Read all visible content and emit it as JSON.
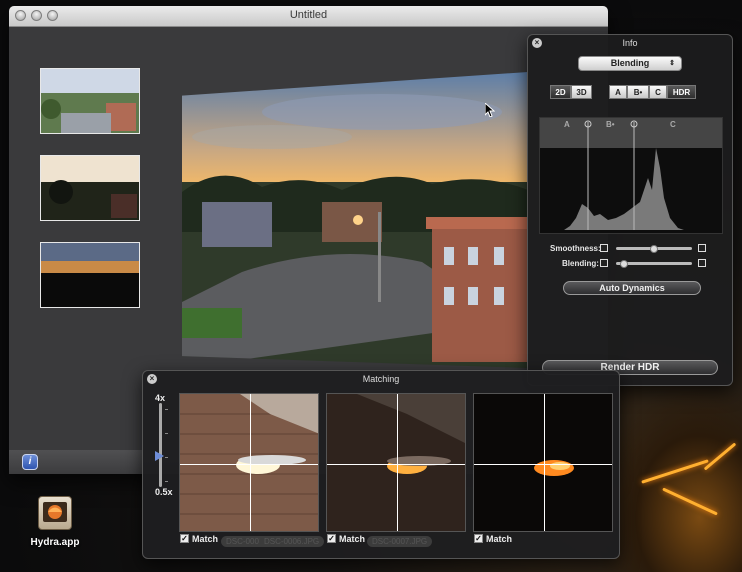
{
  "window": {
    "title": "Untitled",
    "thumbnails": [
      "thumb-bright",
      "thumb-medium",
      "thumb-dark"
    ],
    "info_button": "i"
  },
  "info_panel": {
    "title": "Info",
    "mode_select": "Blending",
    "view_toggle": [
      "2D",
      "3D"
    ],
    "channel_toggle": [
      "A",
      "B•",
      "C",
      "HDR"
    ],
    "histogram_markers": [
      "A",
      "B•",
      "C"
    ],
    "smoothness_label": "Smoothness:",
    "smoothness_value": 0.5,
    "blending_label": "Blending:",
    "blending_value": 0.1,
    "auto_dynamics": "Auto Dynamics",
    "render_hdr": "Render HDR"
  },
  "matching_panel": {
    "title": "Matching",
    "zoom_max": "4x",
    "zoom_min": "0.5x",
    "images": [
      {
        "match_label": "Match",
        "checked": true,
        "ghost_text": [
          "DSC-0008.JPG",
          "DSC-0006.JPG"
        ]
      },
      {
        "match_label": "Match",
        "checked": true,
        "ghost_text": [
          "DSC-0007.JPG"
        ]
      },
      {
        "match_label": "Match",
        "checked": true,
        "ghost_text": []
      }
    ]
  },
  "desktop": {
    "app_label": "Hydra.app"
  },
  "colors": {
    "accent_blue": "#6f8ed8",
    "hud_bg": "#1c1c1e",
    "window_bg": "#3a3a3c"
  }
}
